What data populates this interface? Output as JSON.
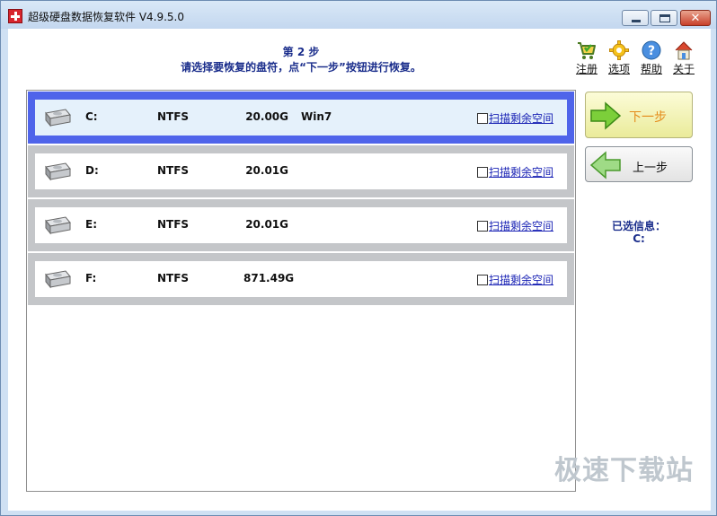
{
  "window": {
    "title": "超级硬盘数据恢复软件 V4.9.5.0"
  },
  "header": {
    "step": "第 2 步",
    "instruction": "请选择要恢复的盘符，点“下一步”按钮进行恢复。"
  },
  "toolbar": {
    "items": [
      {
        "label": "注册",
        "icon": "register-cart-icon"
      },
      {
        "label": "选项",
        "icon": "options-gear-icon"
      },
      {
        "label": "帮助",
        "icon": "help-icon"
      },
      {
        "label": "关于",
        "icon": "about-house-icon"
      }
    ]
  },
  "drives": [
    {
      "letter": "C:",
      "fs": "NTFS",
      "size": "20.00G",
      "label": "Win7",
      "scan_label": "扫描剩余空间",
      "selected": true,
      "scan_checked": false
    },
    {
      "letter": "D:",
      "fs": "NTFS",
      "size": "20.01G",
      "label": "",
      "scan_label": "扫描剩余空间",
      "selected": false,
      "scan_checked": false
    },
    {
      "letter": "E:",
      "fs": "NTFS",
      "size": "20.01G",
      "label": "",
      "scan_label": "扫描剩余空间",
      "selected": false,
      "scan_checked": false
    },
    {
      "letter": "F:",
      "fs": "NTFS",
      "size": "871.49G",
      "label": "",
      "scan_label": "扫描剩余空间",
      "selected": false,
      "scan_checked": false
    }
  ],
  "nav": {
    "next_label": "下一步",
    "prev_label": "上一步"
  },
  "selection": {
    "heading": "已选信息：",
    "value": "C:"
  },
  "watermark": "极速下载站",
  "colors": {
    "selected_border": "#4f64ea",
    "instruction_text": "#1b2e8c",
    "next_label": "#e48b1a",
    "scan_link": "#1a23b5"
  }
}
